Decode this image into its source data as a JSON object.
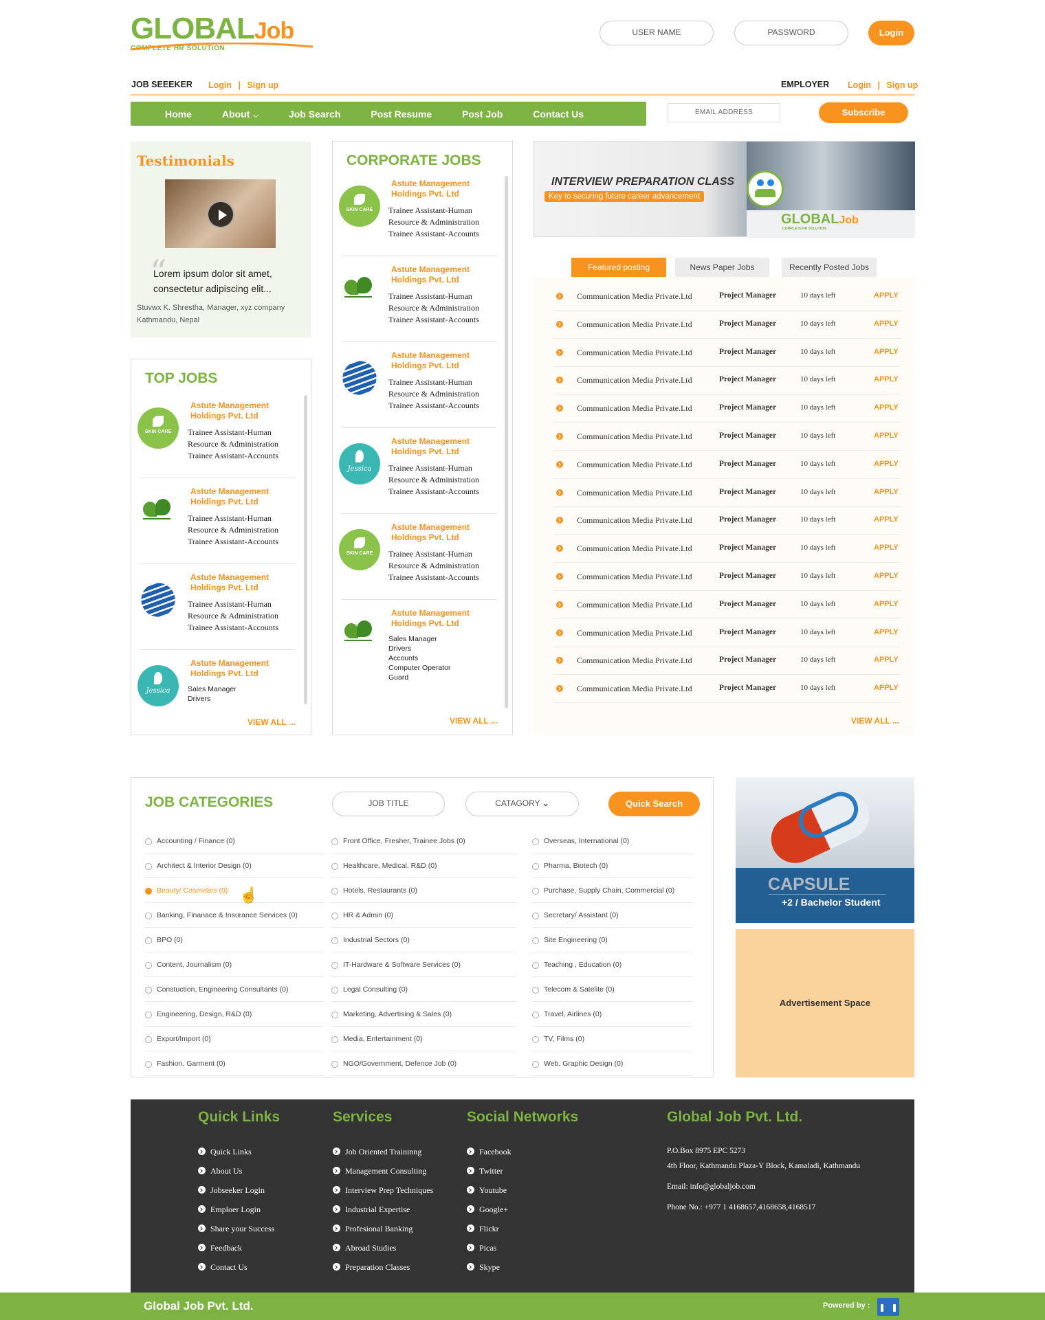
{
  "brand": {
    "logo_main": "GLOBAL",
    "logo_job": "Job",
    "logo_sub": "COMPLETE HR SOLUTION"
  },
  "auth": {
    "username_placeholder": "USER NAME",
    "password_placeholder": "PASSWORD",
    "login_label": "Login"
  },
  "seeker": {
    "label": "JOB SEEEKER",
    "login": "Login",
    "sep": "|",
    "signup": "Sign up"
  },
  "employer": {
    "label": "EMPLOYER",
    "login": "Login",
    "sep": "|",
    "signup": "Sign up"
  },
  "nav": {
    "items": [
      "Home",
      "About",
      "Job Search",
      "Post Resume",
      "Post Job",
      "Contact Us"
    ]
  },
  "subscribe": {
    "email_placeholder": "EMAIL ADDRESS",
    "button": "Subscribe"
  },
  "testimonials": {
    "title": "Testimonials",
    "quote": "Lorem ipsum dolor sit amet, consectetur adipiscing elit...",
    "author": "Stuvwx K. Shrestha, Manager, xyz company",
    "location": "Kathmandu, Nepal"
  },
  "top_jobs": {
    "title": "TOP JOBS",
    "items": [
      {
        "company": "Astute Management Holdings Pvt. Ltd",
        "jobs": [
          "Trainee Assistant-Human",
          "Resource & Administration",
          "Trainee Assistant-Accounts"
        ],
        "logo": "skin-care-logo"
      },
      {
        "company": "Astute Management Holdings Pvt. Ltd",
        "jobs": [
          "Trainee Assistant-Human",
          "Resource & Administration",
          "Trainee Assistant-Accounts"
        ],
        "logo": "ayurveda-logo"
      },
      {
        "company": "Astute Management Holdings Pvt. Ltd",
        "jobs": [
          "Trainee Assistant-Human",
          "Resource & Administration",
          "Trainee Assistant-Accounts"
        ],
        "logo": "globe-logo"
      },
      {
        "company": "Astute Management Holdings Pvt. Ltd",
        "jobs": [
          "Sales Manager",
          "Drivers"
        ],
        "logo": "jessica-logo"
      }
    ],
    "view_all": "VIEW ALL ..."
  },
  "corporate_jobs": {
    "title": "CORPORATE JOBS",
    "items": [
      {
        "company": "Astute Management Holdings Pvt. Ltd",
        "jobs": [
          "Trainee Assistant-Human",
          "Resource & Administration",
          "Trainee Assistant-Accounts"
        ],
        "logo": "skin-care-logo"
      },
      {
        "company": "Astute Management Holdings Pvt. Ltd",
        "jobs": [
          "Trainee Assistant-Human",
          "Resource & Administration",
          "Trainee Assistant-Accounts"
        ],
        "logo": "ayurveda-logo"
      },
      {
        "company": "Astute Management Holdings Pvt. Ltd",
        "jobs": [
          "Trainee Assistant-Human",
          "Resource & Administration",
          "Trainee Assistant-Accounts"
        ],
        "logo": "globe-logo"
      },
      {
        "company": "Astute Management Holdings Pvt. Ltd",
        "jobs": [
          "Trainee Assistant-Human",
          "Resource & Administration",
          "Trainee Assistant-Accounts"
        ],
        "logo": "jessica-logo"
      },
      {
        "company": "Astute Management Holdings Pvt. Ltd",
        "jobs": [
          "Trainee Assistant-Human",
          "Resource & Administration",
          "Trainee Assistant-Accounts"
        ],
        "logo": "skin-care-logo"
      },
      {
        "company": "Astute Management Holdings Pvt. Ltd",
        "jobs": [
          "Sales Manager",
          "Drivers",
          "Accounts",
          "Computer Operator",
          "Guard"
        ],
        "logo": "ayurveda-logo"
      }
    ],
    "view_all": "VIEW ALL ..."
  },
  "banner": {
    "title": "INTERVIEW PREPARATION CLASS",
    "subtitle": "Key to securing future career advancement",
    "logo_main": "GLOBAL",
    "logo_job": "Job",
    "logo_sub": "COMPLETE HR SOLUTION"
  },
  "tabs": [
    "Featured posting",
    "News Paper Jobs",
    "Recently Posted Jobs"
  ],
  "featured": {
    "rows": [
      [
        "Communication Media Private.Ltd",
        "Project Manager",
        "10 days left",
        "APPLY"
      ],
      [
        "Communication Media Private.Ltd",
        "Project Manager",
        "10 days left",
        "APPLY"
      ],
      [
        "Communication Media Private.Ltd",
        "Project Manager",
        "10 days left",
        "APPLY"
      ],
      [
        "Communication Media Private.Ltd",
        "Project Manager",
        "10 days left",
        "APPLY"
      ],
      [
        "Communication Media Private.Ltd",
        "Project Manager",
        "10 days left",
        "APPLY"
      ],
      [
        "Communication Media Private.Ltd",
        "Project Manager",
        "10 days left",
        "APPLY"
      ],
      [
        "Communication Media Private.Ltd",
        "Project Manager",
        "10 days left",
        "APPLY"
      ],
      [
        "Communication Media Private.Ltd",
        "Project Manager",
        "10 days left",
        "APPLY"
      ],
      [
        "Communication Media Private.Ltd",
        "Project Manager",
        "10 days left",
        "APPLY"
      ],
      [
        "Communication Media Private.Ltd",
        "Project Manager",
        "10 days left",
        "APPLY"
      ],
      [
        "Communication Media Private.Ltd",
        "Project Manager",
        "10 days left",
        "APPLY"
      ],
      [
        "Communication Media Private.Ltd",
        "Project Manager",
        "10 days left",
        "APPLY"
      ],
      [
        "Communication Media Private.Ltd",
        "Project Manager",
        "10 days left",
        "APPLY"
      ],
      [
        "Communication Media Private.Ltd",
        "Project Manager",
        "10 days left",
        "APPLY"
      ],
      [
        "Communication Media Private.Ltd",
        "Project Manager",
        "10 days left",
        "APPLY"
      ]
    ],
    "view_all": "VIEW ALL ..."
  },
  "categories": {
    "title": "JOB CATEGORIES",
    "job_title_placeholder": "JOB TITLE",
    "category_select": "CATAGORY",
    "search_button": "Quick Search",
    "active": "Beauty/ Cosmetics (0)",
    "col1": [
      "Accounting / Finance (0)",
      "Architect & Interior Design (0)",
      "Beauty/ Cosmetics (0)",
      "Banking, Finanace & Insurance Services (0)",
      "BPO (0)",
      "Content, Journalism (0)",
      "Constuction, Engineering Consultants (0)",
      "Engineering, Design, R&D (0)",
      "Export/Import (0)",
      "Fashion, Garment (0)"
    ],
    "col2": [
      "Front Office, Fresher, Trainee Jobs (0)",
      "Healthcare, Medical, R&D (0)",
      "Hotels, Restaurants (0)",
      "HR & Admin (0)",
      "Industrial Sectors (0)",
      "IT-Hardware & Software Services (0)",
      "Legal Consulting (0)",
      "Marketing, Advertising & Sales (0)",
      "Media, Entertainment (0)",
      "NGO/Government, Defence Job (0)"
    ],
    "col3": [
      "Overseas, International (0)",
      "Pharma, Biotech (0)",
      "Purchase, Supply Chain, Commercial (0)",
      "Secretary/ Assistant (0)",
      "Site Engineering (0)",
      "Teaching , Education (0)",
      "Telecom & Satelite (0)",
      "Travel, Airlines (0)",
      "TV, Films (0)",
      "Web, Graphic Design (0)"
    ]
  },
  "ads": {
    "capsule_title": "CAPSULE",
    "capsule_sub": "+2 / Bachelor Student",
    "space": "Advertisement Space"
  },
  "footer": {
    "quick_links": {
      "title": "Quick Links",
      "items": [
        "Quick Links",
        "About Us",
        "Jobseeker Login",
        "Emploer Login",
        "Share your Success",
        "Feedback",
        "Contact Us"
      ]
    },
    "services": {
      "title": "Services",
      "items": [
        "Job Oriented Traininng",
        "Management Consulting",
        "Interview Prep Techniques",
        "Industrial Expertise",
        "Profesional Banking",
        "Abroad Studies",
        "Preparation Classes"
      ]
    },
    "social": {
      "title": "Social Networks",
      "items": [
        "Facebook",
        "Twitter",
        "Youtube",
        "Google+",
        "Flickr",
        "Picas",
        "Skype"
      ]
    },
    "company": {
      "title": "Global Job Pvt. Ltd.",
      "po_box": "P.O.Box 8975 EPC 5273",
      "address": "4th Floor, Kathmandu Plaza-Y Block, Kamaladi, Kathmandu",
      "email": "Email: info@globaljob.com",
      "phone": "Phone No.: +977 1 4168657,4168658,4168517"
    }
  },
  "bottom": {
    "company": "Global Job Pvt. Ltd.",
    "powered": "Powered by :"
  },
  "colors": {
    "green": "#7cb342",
    "orange": "#f7931e",
    "footer": "#333333",
    "capsule": "#245f93",
    "ad": "#fad39c"
  }
}
